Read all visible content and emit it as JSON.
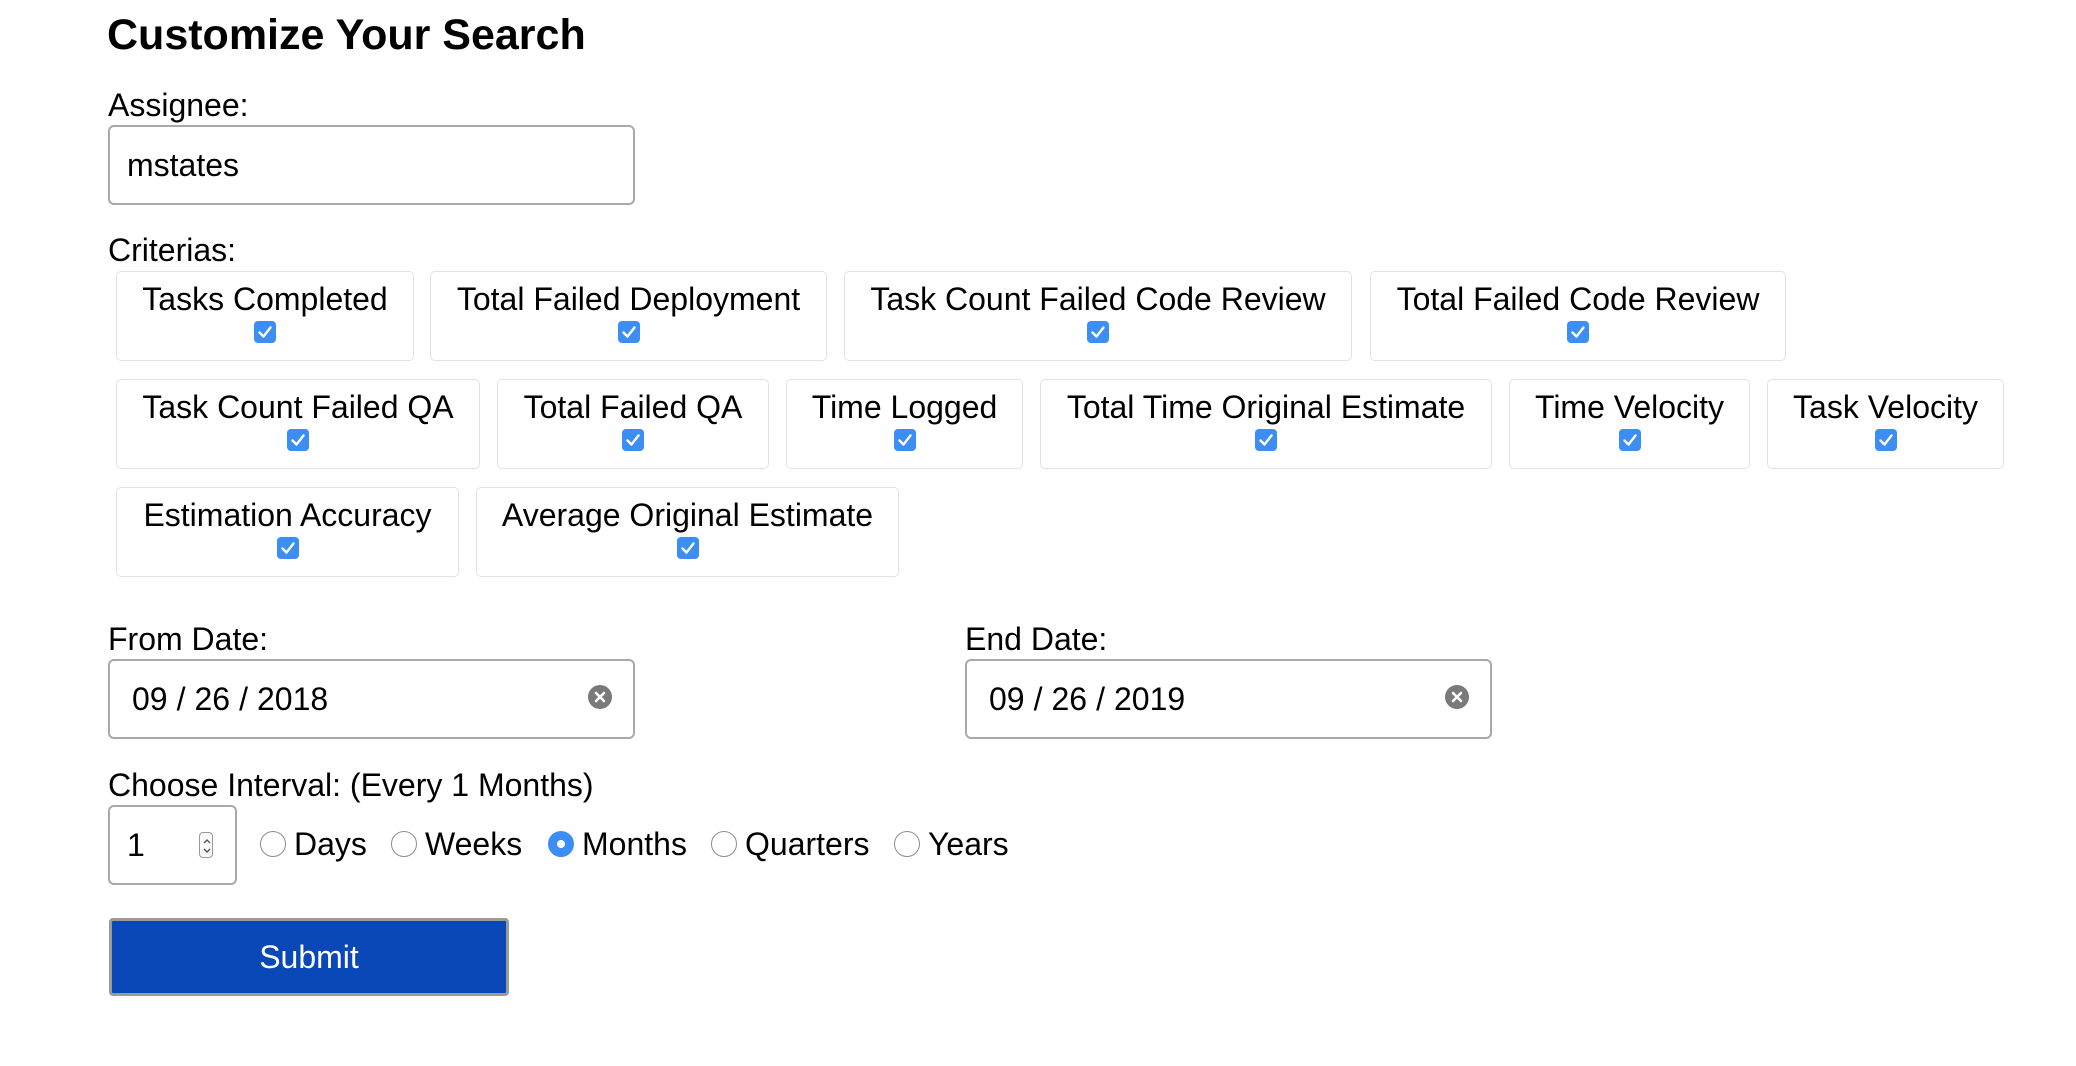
{
  "title": "Customize Your Search",
  "assignee": {
    "label": "Assignee:",
    "value": "mstates"
  },
  "criterias": {
    "label": "Criterias:",
    "items": [
      {
        "label": "Tasks Completed",
        "checked": true
      },
      {
        "label": "Total Failed Deployment",
        "checked": true
      },
      {
        "label": "Task Count Failed Code Review",
        "checked": true
      },
      {
        "label": "Total Failed Code Review",
        "checked": true
      },
      {
        "label": "Task Count Failed QA",
        "checked": true
      },
      {
        "label": "Total Failed QA",
        "checked": true
      },
      {
        "label": "Time Logged",
        "checked": true
      },
      {
        "label": "Total Time Original Estimate",
        "checked": true
      },
      {
        "label": "Time Velocity",
        "checked": true
      },
      {
        "label": "Task Velocity",
        "checked": true
      },
      {
        "label": "Estimation Accuracy",
        "checked": true
      },
      {
        "label": "Average Original Estimate",
        "checked": true
      }
    ]
  },
  "from_date": {
    "label": "From Date:",
    "month": "09",
    "day": "26",
    "year": "2018",
    "clear_icon": "clear-circle-icon"
  },
  "end_date": {
    "label": "End Date:",
    "month": "09",
    "day": "26",
    "year": "2019",
    "clear_icon": "clear-circle-icon"
  },
  "interval": {
    "label": "Choose Interval: (Every 1 Months)",
    "value": "1",
    "options": [
      {
        "label": "Days",
        "checked": false
      },
      {
        "label": "Weeks",
        "checked": false
      },
      {
        "label": "Months",
        "checked": true
      },
      {
        "label": "Quarters",
        "checked": false
      },
      {
        "label": "Years",
        "checked": false
      }
    ]
  },
  "submit_label": "Submit",
  "colors": {
    "accent": "#3c8ef5",
    "submit_bg": "#0a47b7"
  }
}
